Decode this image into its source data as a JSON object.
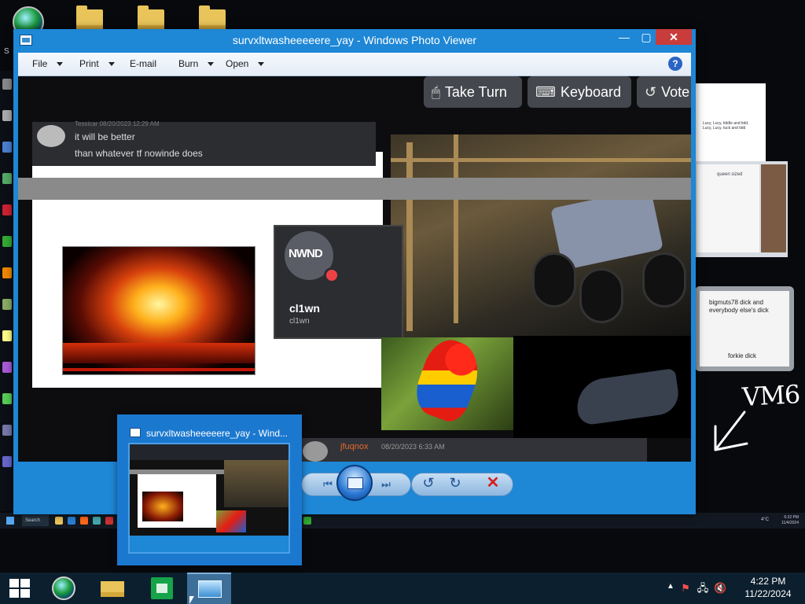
{
  "desktop": {
    "side_label": "S",
    "vm_label": "VM6",
    "note_text_1": "bigmuts78 dick and everybody else's dick",
    "note_text_2": "forkie dick",
    "doc_caption": "Lucy, Lucy, tiddle and tidd, Lucy, Lucy, tuck and tidd",
    "window2_text": "queen sized"
  },
  "photo_viewer": {
    "title": "survxltwasheeeeere_yay - Windows Photo Viewer",
    "controls": {
      "minimize": "—",
      "maximize": "▢",
      "close": "✕"
    },
    "menu": [
      {
        "label": "File"
      },
      {
        "label": "Print"
      },
      {
        "label": "E-mail"
      },
      {
        "label": "Burn"
      },
      {
        "label": "Open"
      }
    ],
    "help": "?",
    "image": {
      "buttons": {
        "take_turn": "Take Turn",
        "keyboard": "Keyboard",
        "vote": "Vote"
      },
      "chat_top": {
        "line1": "it will be better",
        "line2": "than whatever tf nowinde does",
        "header": "Tessicar 08/20/2023 12:29 AM"
      },
      "discord_card": {
        "pfp_text": "NWND",
        "name": "cl1wn",
        "tag": "cl1wn"
      },
      "chat_bottom": {
        "user": "jfuqnox",
        "date": "08/20/2023 6:33 AM"
      }
    },
    "bottom_controls": {
      "prev": "⏮",
      "next": "⏭",
      "rotate_ccw": "↺",
      "rotate_cw": "↻",
      "delete": "✕"
    }
  },
  "thumbnail": {
    "title": "survxltwasheeeeere_yay - Wind..."
  },
  "inner_taskbar": {
    "search": "Search",
    "clock": "6:32 PM 11/4/2024",
    "temp": "4°C"
  },
  "taskbar": {
    "tray": {
      "show_hidden": "▲",
      "flag": "⚑",
      "network": "🖧",
      "volume": "🔇"
    },
    "clock": {
      "time": "4:22 PM",
      "date": "11/22/2024"
    }
  }
}
